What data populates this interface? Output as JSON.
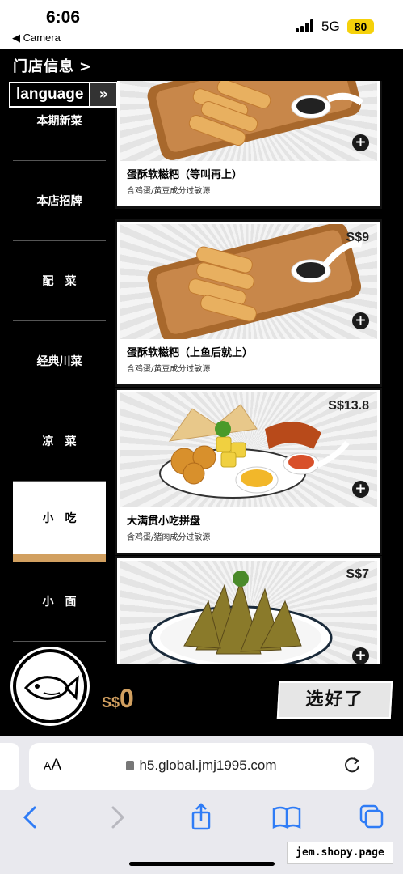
{
  "status_bar": {
    "time": "6:06",
    "back_label": "◀ Camera",
    "network": "5G",
    "battery": "80",
    "battery_color": "#f5d10a"
  },
  "header": {
    "store_info_label": "门店信息",
    "language_label": "language"
  },
  "sidebar": {
    "items": [
      {
        "label": "本期新菜"
      },
      {
        "label": "本店招牌"
      },
      {
        "label": "配　菜"
      },
      {
        "label": "经典川菜"
      },
      {
        "label": "凉　菜"
      },
      {
        "label": "小　吃"
      },
      {
        "label": "小　面"
      }
    ],
    "active_index": 5,
    "accent_color": "#d2a060"
  },
  "menu": {
    "items": [
      {
        "name": "蛋酥软糍粑（等叫再上）",
        "note": "含鸡蛋/黄豆成分过敏源",
        "price": "",
        "dish": "ciba"
      },
      {
        "name": "蛋酥软糍粑（上鱼后就上）",
        "note": "含鸡蛋/黄豆成分过敏源",
        "price": "S$9",
        "dish": "ciba"
      },
      {
        "name": "大满贯小吃拼盘",
        "note": "含鸡蛋/猪肉成分过敏源",
        "price": "S$13.8",
        "dish": "platter"
      },
      {
        "name": "",
        "note": "",
        "price": "S$7",
        "dish": "cones"
      }
    ]
  },
  "cart": {
    "currency": "S$",
    "amount": "0",
    "choose_label": "选好了"
  },
  "browser": {
    "aa_label": "AA",
    "url": "h5.global.jmj1995.com"
  },
  "watermark": "jem.shopy.page"
}
